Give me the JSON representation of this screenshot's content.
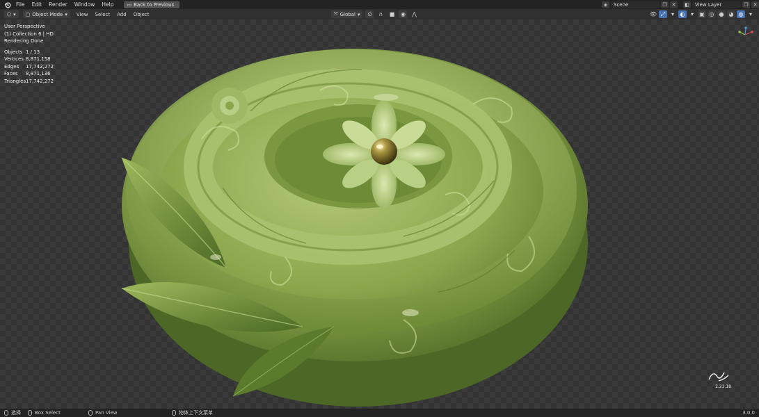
{
  "menubar": {
    "items": [
      "File",
      "Edit",
      "Render",
      "Window",
      "Help"
    ],
    "back_button": "Back to Previous",
    "scene_name": "Scene",
    "view_layer": "View Layer"
  },
  "viewport_header": {
    "mode": "Object Mode",
    "menus": [
      "View",
      "Select",
      "Add",
      "Object"
    ],
    "orientation": "Global"
  },
  "overlay": {
    "perspective": "User Perspective",
    "collection": "(1) Collection 6 | HD",
    "render_status": "Rendering Done"
  },
  "stats": [
    {
      "label": "Objects",
      "value": "1 / 13"
    },
    {
      "label": "Vertices",
      "value": "8,871,158"
    },
    {
      "label": "Edges",
      "value": "17,742,272"
    },
    {
      "label": "Faces",
      "value": "8,871,136"
    },
    {
      "label": "Triangles",
      "value": "17,742,272"
    }
  ],
  "signature": {
    "date": "2.21.18"
  },
  "statusbar": {
    "select": "选择",
    "box_select": "Box Select",
    "pan_view": "Pan View",
    "context_menu": "物体上下文菜单",
    "version": "3.0.0"
  },
  "colors": {
    "accent": "#4772b3",
    "jade_light": "#a8c06a",
    "jade_mid": "#7f9a45",
    "jade_dark": "#4c6326",
    "pearl": "#8a7a35"
  }
}
